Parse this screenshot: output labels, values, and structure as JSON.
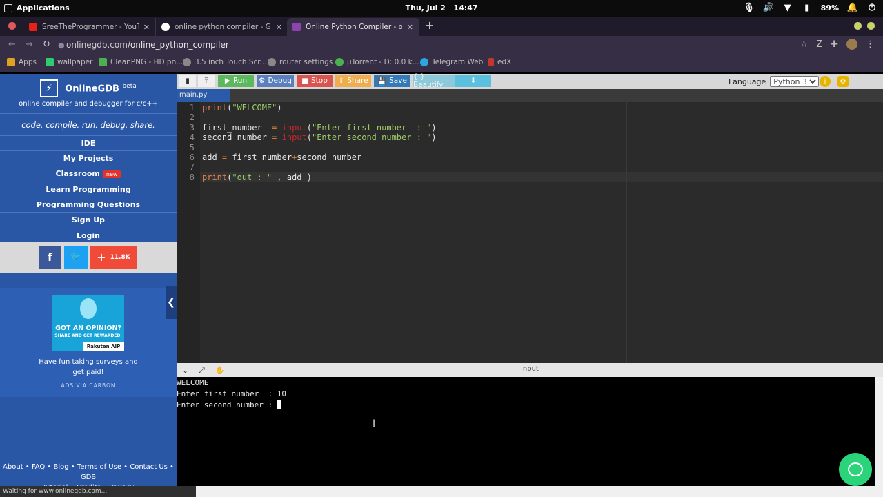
{
  "os": {
    "apps_label": "Applications",
    "date": "Thu, Jul 2",
    "time": "14:47",
    "battery": "89%"
  },
  "browser": {
    "tabs": [
      {
        "title": "SreeTheProgrammer - YouTube",
        "favicon_color": "#e62117"
      },
      {
        "title": "online python compiler - Google Search",
        "favicon_color": "#4285f4"
      },
      {
        "title": "Online Python Compiler - online editor",
        "favicon_color": "#8e44ad"
      }
    ],
    "new_tab": "+",
    "url_domain": "onlinegdb.com",
    "url_path": "/online_python_compiler",
    "bookmarks": [
      {
        "label": "Apps",
        "color": "#e0a020"
      },
      {
        "label": "wallpaper",
        "color": "#2ecc71"
      },
      {
        "label": "CleanPNG - HD pn...",
        "color": "#4caf50"
      },
      {
        "label": "3.5 inch Touch Scr...",
        "color": "#888888"
      },
      {
        "label": "router settings",
        "color": "#888888"
      },
      {
        "label": "µTorrent - D: 0.0 k...",
        "color": "#4caf50"
      },
      {
        "label": "Telegram Web",
        "color": "#2ca5e0"
      },
      {
        "label": "edX",
        "color": "#c0392b"
      }
    ]
  },
  "sidebar": {
    "brand": "OnlineGDB",
    "brand_sup": "beta",
    "tagline": "online compiler and debugger for c/c++",
    "motto": "code. compile. run. debug. share.",
    "items": [
      {
        "label": "IDE"
      },
      {
        "label": "My Projects"
      },
      {
        "label": "Classroom",
        "badge": "new"
      },
      {
        "label": "Learn Programming"
      },
      {
        "label": "Programming Questions"
      },
      {
        "label": "Sign Up"
      },
      {
        "label": "Login"
      }
    ],
    "share_count": "11.8K",
    "ad": {
      "headline": "GOT AN OPINION?",
      "subline": "SHARE AND GET REWARDED.",
      "brand": "Rakuten AIP",
      "copy_line1": "Have fun taking surveys and",
      "copy_line2": "get paid!",
      "via": "ADS VIA CARBON"
    },
    "footer_line1": "About • FAQ • Blog • Terms of Use • Contact Us • GDB",
    "footer_line2": "Tutorial • Credits • Privacy",
    "status": "Waiting for www.onlinegdb.com..."
  },
  "toolbar": {
    "run": "Run",
    "debug": "Debug",
    "stop": "Stop",
    "share": "Share",
    "save": "Save",
    "beautify": "{ } Beautify",
    "language_label": "Language",
    "language_value": "Python 3",
    "colors": {
      "run": "#5cb85c",
      "debug": "#5b7fbe",
      "stop": "#d9534f",
      "share": "#f0ad4e",
      "save": "#337ab7",
      "beautify": "#5bc0de"
    }
  },
  "file_tab": "main.py",
  "editor": {
    "lines": [
      "1",
      "2",
      "3",
      "4",
      "5",
      "6",
      "7",
      "8"
    ]
  },
  "splitter": {
    "label": "input"
  },
  "terminal": {
    "line1": "WELCOME",
    "line2": "Enter first number  : 10",
    "line3": "Enter second number : "
  }
}
